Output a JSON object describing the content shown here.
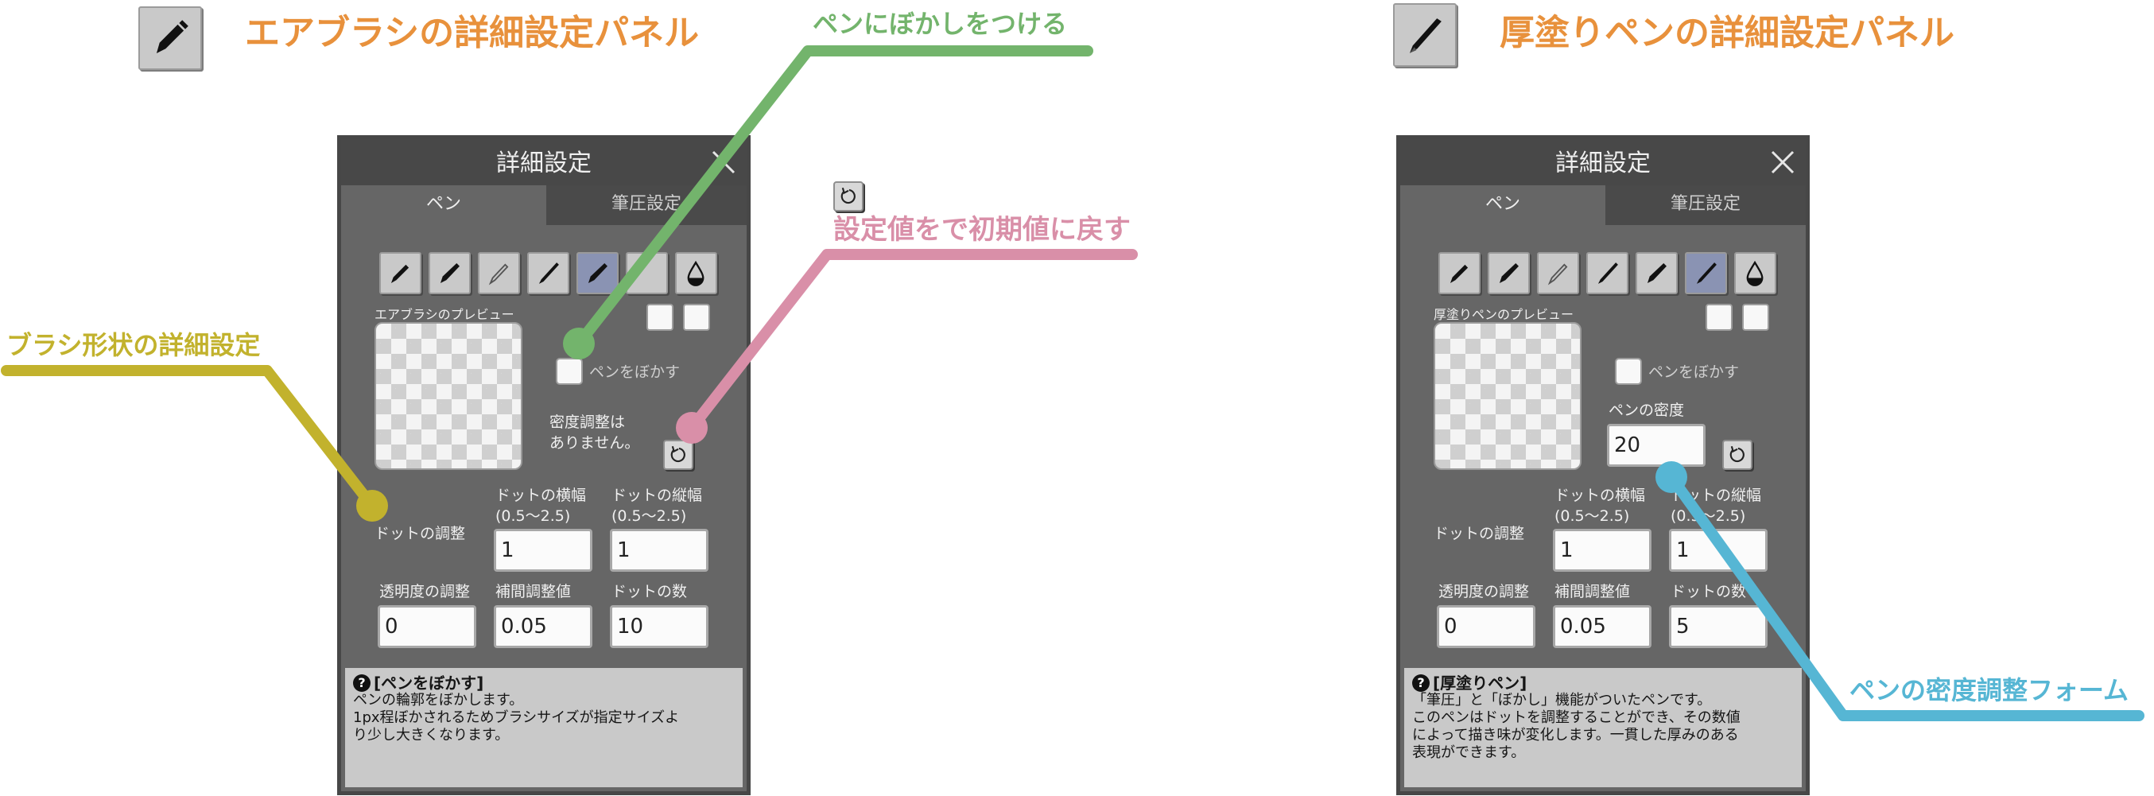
{
  "colors": {
    "title_orange": "#e8913c",
    "green": "#73b46c",
    "pink": "#d98fa8",
    "yellow": "#c2b22d",
    "cyan": "#56b6d4"
  },
  "left_header": {
    "icon": "pen-icon",
    "title": "エアブラシの詳細設定パネル"
  },
  "right_header": {
    "icon": "brush-icon",
    "title": "厚塗りペンの詳細設定パネル"
  },
  "annotations": {
    "blur": "ペンにぼかしをつける",
    "reset": "設定値をで初期値に戻す",
    "brush_shape": "ブラシ形状の詳細設定",
    "density_form": "ペンの密度調整フォーム"
  },
  "left_panel": {
    "title": "詳細設定",
    "tabs": [
      "ペン",
      "筆圧設定"
    ],
    "preview_label": "エアブラシのプレビュー",
    "blur_checkbox_label": "ペンをぼかす",
    "density_note_line1": "密度調整は",
    "density_note_line2": "ありません。",
    "dot_adjust_label": "ドットの調整",
    "dot_width_label": "ドットの横幅",
    "dot_width_range": "(0.5〜2.5)",
    "dot_height_label": "ドットの縦幅",
    "dot_height_range": "(0.5〜2.5)",
    "dot_width_value": "1",
    "dot_height_value": "1",
    "opacity_label": "透明度の調整",
    "interp_label": "補間調整値",
    "dot_count_label": "ドットの数",
    "opacity_value": "0",
    "interp_value": "0.05",
    "dot_count_value": "10",
    "help_title": "[ペンをぼかす]",
    "help_line1": "ペンの輪郭をぼかします。",
    "help_line2": "1px程ぼかされるためブラシサイズが指定サイズよ",
    "help_line3": "り少し大きくなります。"
  },
  "right_panel": {
    "title": "詳細設定",
    "tabs": [
      "ペン",
      "筆圧設定"
    ],
    "preview_label": "厚塗りペンのプレビュー",
    "blur_checkbox_label": "ペンをぼかす",
    "density_label": "ペンの密度",
    "density_value": "20",
    "dot_adjust_label": "ドットの調整",
    "dot_width_label": "ドットの横幅",
    "dot_width_range": "(0.5〜2.5)",
    "dot_height_label": "ドットの縦幅",
    "dot_height_range": "(0.5〜2.5)",
    "dot_width_value": "1",
    "dot_height_value": "1",
    "opacity_label": "透明度の調整",
    "interp_label": "補間調整値",
    "dot_count_label": "ドットの数",
    "opacity_value": "0",
    "interp_value": "0.05",
    "dot_count_value": "5",
    "help_title": "[厚塗りペン]",
    "help_line1": "「筆圧」と「ぼかし」機能がついたペンです。",
    "help_line2": "このペンはドットを調整することができ、その数値",
    "help_line3": "によって描き味が変化します。一貫した厚みのある",
    "help_line4": "表現ができます。"
  }
}
